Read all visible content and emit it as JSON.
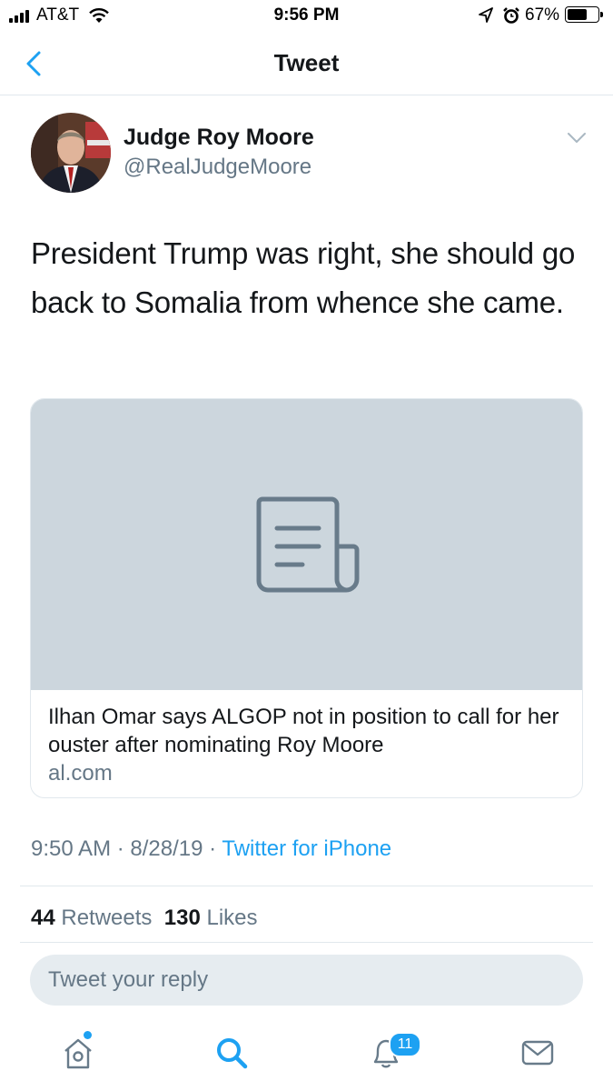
{
  "status_bar": {
    "carrier": "AT&T",
    "time": "9:56 PM",
    "battery_percent": "67%",
    "battery_level": 0.67
  },
  "nav": {
    "title": "Tweet",
    "back_icon": "chevron-left-icon"
  },
  "tweet": {
    "author_name": "Judge Roy Moore",
    "author_handle": "@RealJudgeMoore",
    "text": "President Trump was right, she should go back to Somalia from whence she came.",
    "card": {
      "title": "Ilhan Omar says ALGOP not in position to call for her ouster after nominating Roy Moore",
      "domain": "al.com",
      "icon": "article-icon"
    },
    "time": "9:50 AM",
    "date": "8/28/19",
    "separator": "·",
    "source": "Twitter for iPhone",
    "retweets_count": "44",
    "retweets_label": "Retweets",
    "likes_count": "130",
    "likes_label": "Likes"
  },
  "reply": {
    "placeholder": "Tweet your reply"
  },
  "tab_bar": {
    "notifications_badge": "11",
    "icons": [
      "home-icon",
      "search-icon",
      "notifications-icon",
      "messages-icon"
    ]
  },
  "colors": {
    "accent": "#1da1f2",
    "secondary_text": "#657786",
    "card_placeholder": "#ccd6dd"
  }
}
